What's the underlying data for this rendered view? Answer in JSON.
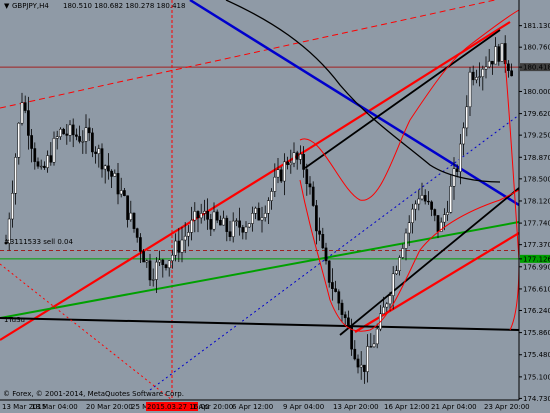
{
  "header": {
    "symbol_timeframe": "GBPJPY,H4",
    "ohlc": "180.510 180.682 180.278 180.418"
  },
  "chart_data": {
    "type": "candlestick",
    "timeframe": "H4",
    "ylim": [
      174.72,
      181.33
    ],
    "y_ticks": [
      "181.130",
      "180.760",
      "180.418",
      "180.000",
      "179.620",
      "179.250",
      "178.870",
      "178.500",
      "178.120",
      "177.740",
      "177.370",
      "177.126",
      "176.990",
      "176.610",
      "176.240",
      "175.860",
      "175.480",
      "175.100",
      "174.730"
    ],
    "current_price": "180.418",
    "time_labels": [
      "13 Mar 2015",
      "18 Mar 04:00",
      "20 Mar 20:00",
      "25 Mar 12:00",
      "2015.03.27 16:00",
      "1 Apr 20:00",
      "6 Apr 12:00",
      "9 Apr 04:00",
      "13 Apr 20:00",
      "16 Apr 12:00",
      "21 Apr 04:00",
      "23 Apr 20:00"
    ],
    "highlight_time": "2015.03.27 16:00",
    "order_label": "#3111533 sell 0.04",
    "support_label": "1TuSu",
    "watermark": "© Forex, © 2001-2014, MetaQuotes Software Corp.",
    "grid": false,
    "colors": {
      "background": "#8f9aa6",
      "bull_candle": "#ffffff",
      "bear_candle": "#000000",
      "red_line": "#ff0000",
      "blue_line": "#0000cc",
      "green_line": "#00a000",
      "black_line": "#000000",
      "tick_highlight_green": "#00a000",
      "tick_highlight_gray": "#404040"
    }
  }
}
